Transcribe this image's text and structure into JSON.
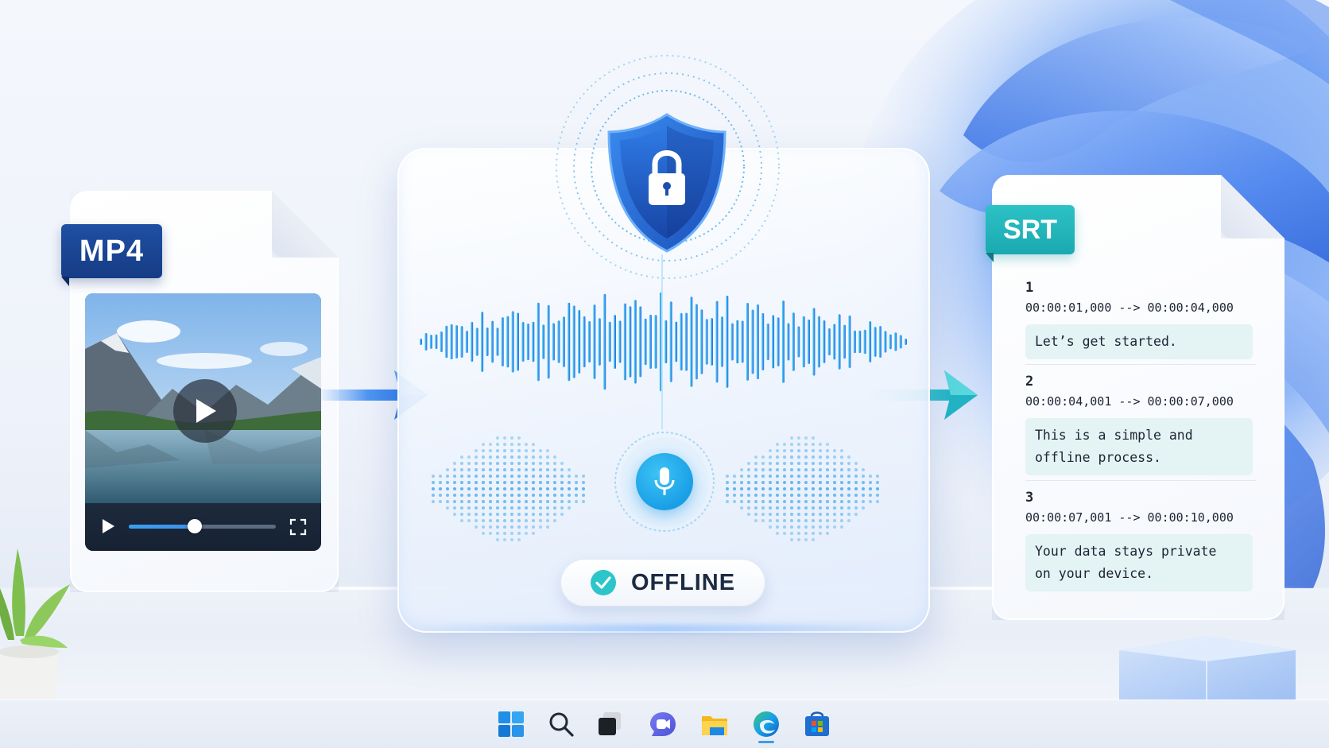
{
  "input_file": {
    "format_badge": "MP4",
    "video_player": {
      "progress": 0.45
    }
  },
  "processing": {
    "status_label": "OFFLINE",
    "icons": [
      "shield-lock-icon",
      "microphone-icon",
      "check-icon"
    ]
  },
  "output_file": {
    "format_badge": "SRT",
    "subtitles": [
      {
        "index": "1",
        "time": "00:00:01,000 --> 00:00:04,000",
        "text": "Let’s get started."
      },
      {
        "index": "2",
        "time": "00:00:04,001 --> 00:00:07,000",
        "text": "This is a simple and\noffline process."
      },
      {
        "index": "3",
        "time": "00:00:07,001 --> 00:00:10,000",
        "text": "Your data stays private\non your device."
      }
    ]
  },
  "taskbar": {
    "items": [
      "start-icon",
      "search-icon",
      "task-view-icon",
      "chat-icon",
      "file-explorer-icon",
      "edge-icon",
      "store-icon"
    ],
    "active_item": "edge-icon"
  },
  "colors": {
    "mp4_badge": "#1f4fa3",
    "srt_badge": "#2cc2c6",
    "accent_blue": "#1a9fe6",
    "offline_check": "#2cc5c9"
  }
}
